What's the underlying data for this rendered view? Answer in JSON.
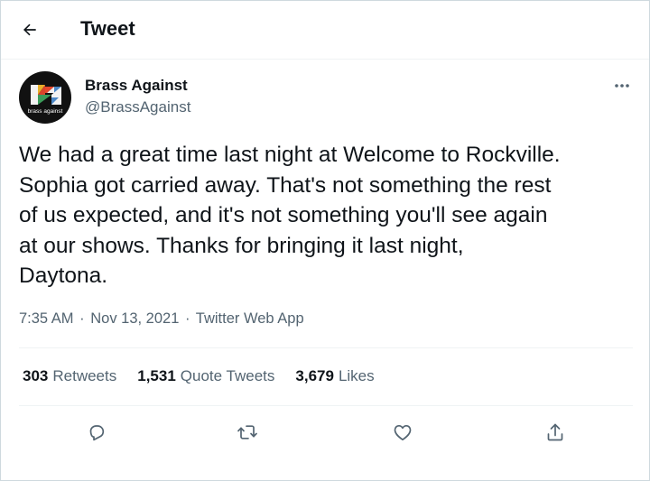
{
  "header": {
    "title": "Tweet"
  },
  "author": {
    "name": "Brass Against",
    "handle": "@BrassAgainst",
    "avatar_text": "brass against"
  },
  "tweet": {
    "text": "We had a great time last night at Welcome to Rockville.\nSophia got carried away. That's not something the rest\nof us expected, and it's not something you'll see again\nat our shows. Thanks for bringing it last night,\nDaytona.",
    "time": "7:35 AM",
    "date": "Nov 13, 2021",
    "source": "Twitter Web App",
    "separator": "·"
  },
  "stats": {
    "retweets_count": "303",
    "retweets_label": "Retweets",
    "quotes_count": "1,531",
    "quotes_label": "Quote Tweets",
    "likes_count": "3,679",
    "likes_label": "Likes"
  },
  "icons": {
    "back": "arrow-left-icon",
    "more": "more-horizontal-icon",
    "reply": "reply-icon",
    "retweet": "retweet-icon",
    "like": "heart-icon",
    "share": "share-icon"
  },
  "colors": {
    "text": "#0f1419",
    "secondary": "#536471",
    "divider": "#eff3f4",
    "border": "#cfd9de"
  }
}
